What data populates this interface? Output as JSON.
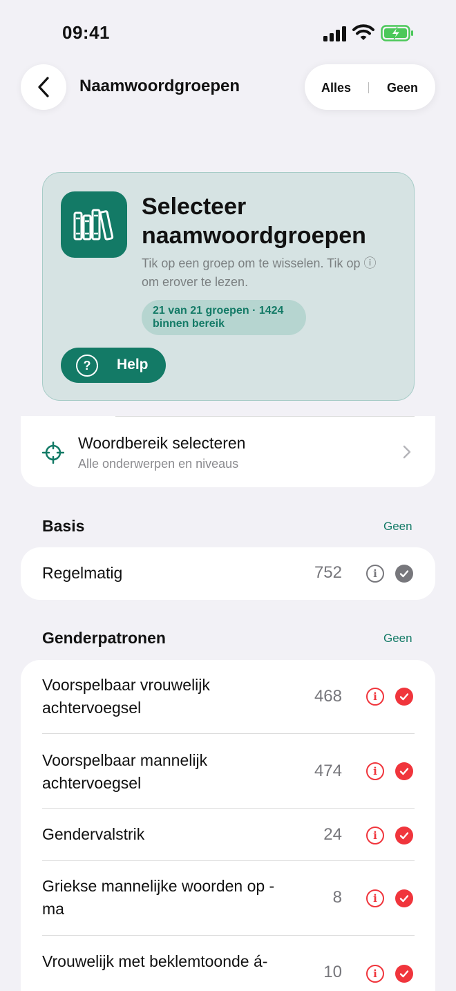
{
  "status_bar": {
    "time": "09:41"
  },
  "nav": {
    "title": "Naamwoordgroepen",
    "select_all": "Alles",
    "select_none": "Geen"
  },
  "hero": {
    "title": "Selecteer naamwoordgroepen",
    "subtitle": "Tik op een groep om te wisselen. Tik op ⓘ om erover te lezen.",
    "pill": "21 van 21 groepen · 1424 binnen bereik",
    "help_label": "Help"
  },
  "range": {
    "title": "Woordbereik selecteren",
    "subtitle": "Alle onderwerpen en niveaus"
  },
  "colors": {
    "accent": "#137a66",
    "selected": "#f0353c",
    "neutral": "#77777c"
  },
  "sections": [
    {
      "title": "Basis",
      "action": "Geen",
      "rows": [
        {
          "label": "Regelmatig",
          "count": "752",
          "selected": false
        }
      ]
    },
    {
      "title": "Genderpatronen",
      "action": "Geen",
      "rows": [
        {
          "label": "Voorspelbaar vrouwelijk achtervoegsel",
          "count": "468",
          "selected": true
        },
        {
          "label": "Voorspelbaar mannelijk achtervoegsel",
          "count": "474",
          "selected": true
        },
        {
          "label": "Gendervalstrik",
          "count": "24",
          "selected": true
        },
        {
          "label": "Griekse mannelijke woorden op -ma",
          "count": "8",
          "selected": true
        },
        {
          "label": "Vrouwelijk met beklemtoonde á-",
          "count": "10",
          "selected": true
        }
      ]
    }
  ]
}
